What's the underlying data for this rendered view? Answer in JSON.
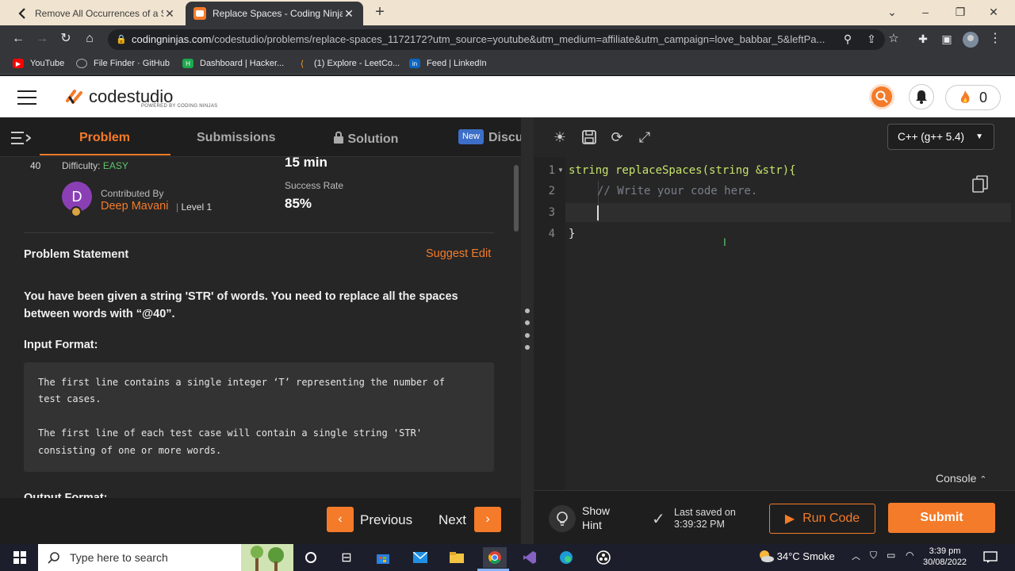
{
  "browser": {
    "tabs": [
      {
        "title": "Remove All Occurrences of a Sub",
        "active": false
      },
      {
        "title": "Replace Spaces - Coding Ninjas C",
        "active": true
      }
    ],
    "url_domain": "codingninjas.com",
    "url_path": "/codestudio/problems/replace-spaces_1172172?utm_source=youtube&utm_medium=affiliate&utm_campaign=love_babbar_5&leftPa...",
    "bookmarks": [
      "YouTube",
      "File Finder · GitHub",
      "Dashboard | Hacker...",
      "(1) Explore - LeetCo...",
      "Feed | LinkedIn"
    ]
  },
  "site": {
    "logo_text": "codestudio",
    "logo_sub": "POWERED BY CODING NINJAS",
    "streak_count": "0",
    "accent": "#f47b29"
  },
  "left_panel": {
    "tabs": {
      "problem": "Problem",
      "submissions": "Submissions",
      "solution": "Solution",
      "new_badge": "New",
      "discuss": "Discu"
    },
    "meta": {
      "number": "40",
      "difficulty_label": "Difficulty:",
      "difficulty_value": "EASY",
      "time": "15 min",
      "contributed_by": "Contributed By",
      "avatar_letter": "D",
      "author": "Deep Mavani",
      "level": "Level 1",
      "success_rate_label": "Success Rate",
      "success_rate": "85%"
    },
    "problem_statement_label": "Problem Statement",
    "suggest_edit": "Suggest Edit",
    "statement_lines": [
      "You have been given a string 'STR' of words. You need to replace all the spaces",
      "between words with “@40”."
    ],
    "input_format_label": "Input Format:",
    "code_block": [
      "The first line contains a single integer ‘T’ representing the number of",
      "test cases.",
      "",
      "The first line of each test case will contain a single string 'STR'",
      "consisting of one or more words."
    ],
    "next_heading_partial": "Output Format:",
    "previous": "Previous",
    "next": "Next"
  },
  "editor": {
    "language": "C++ (g++ 5.4)",
    "line_numbers": [
      "1",
      "2",
      "3",
      "4"
    ],
    "code": {
      "l1_type": "string",
      "l1_fn": " replaceSpaces(",
      "l1_param_type": "string",
      "l1_rest": " &str){",
      "l2_comment": "// Write your code here.",
      "l4": "}"
    },
    "console": "Console",
    "show_hint": [
      "Show",
      "Hint"
    ],
    "last_saved_label": "Last saved on",
    "last_saved_time": "3:39:32 PM",
    "run_code": "Run Code",
    "submit": "Submit"
  },
  "taskbar": {
    "search_placeholder": "Type here to search",
    "weather": "34°C  Smoke",
    "time": "3:39 pm",
    "date": "30/08/2022"
  }
}
